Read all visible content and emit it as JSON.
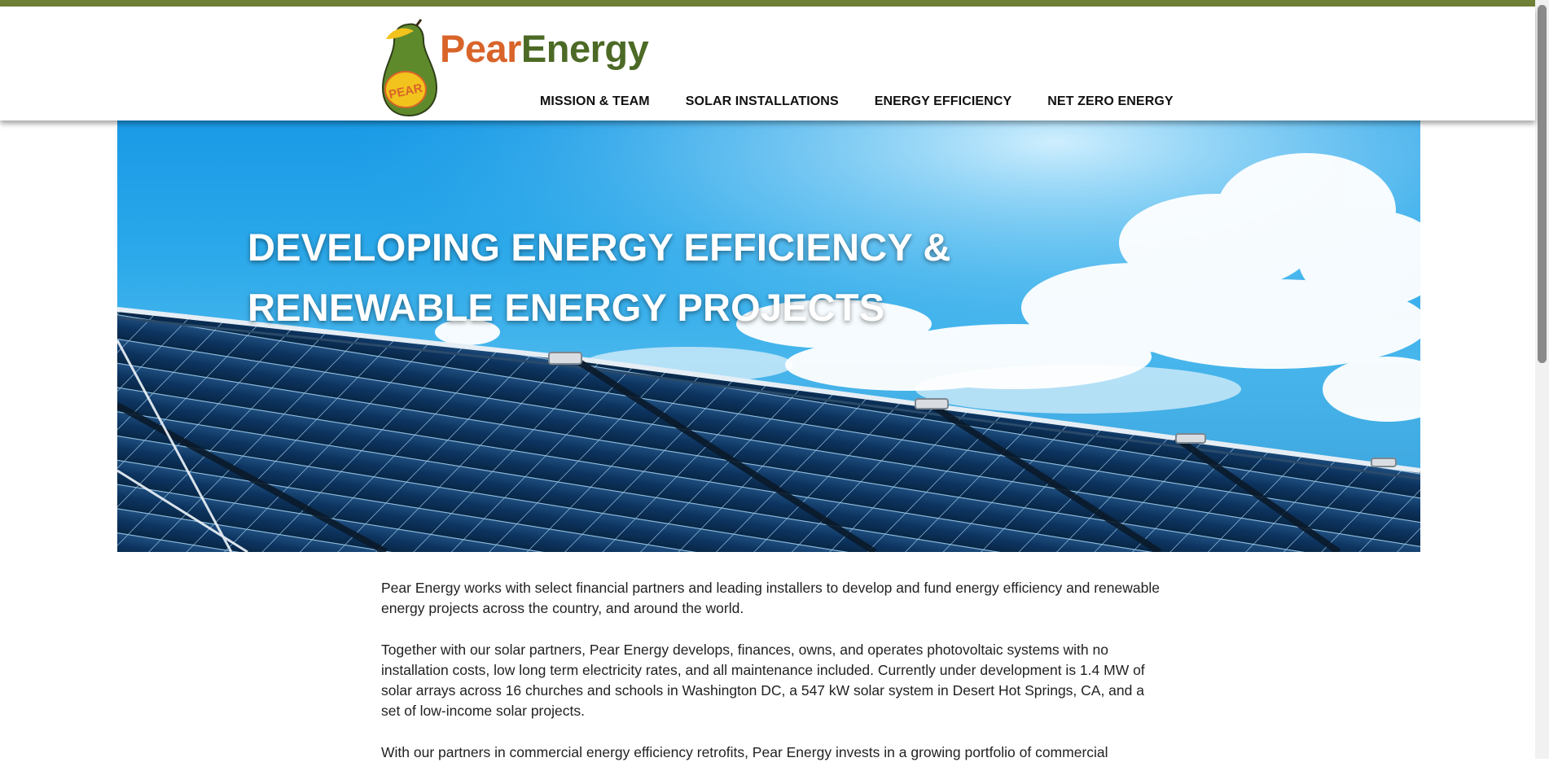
{
  "brand": {
    "name_part1": "Pear",
    "name_part2": "Energy",
    "badge": "PEAR",
    "colors": {
      "green": "#6e7f36",
      "dark_green": "#4c6a25",
      "orange": "#d9642a",
      "yellow": "#f2c31c"
    }
  },
  "nav": {
    "items": [
      {
        "label": "MISSION & TEAM"
      },
      {
        "label": "SOLAR INSTALLATIONS"
      },
      {
        "label": "ENERGY EFFICIENCY"
      },
      {
        "label": "NET ZERO ENERGY"
      }
    ]
  },
  "hero": {
    "title_line1": "DEVELOPING ENERGY EFFICIENCY &",
    "title_line2": "RENEWABLE ENERGY PROJECTS",
    "image": "solar-panels-under-blue-sky"
  },
  "content": {
    "paragraphs": [
      "Pear Energy works with select financial partners and leading installers to develop and fund energy efficiency and renewable energy projects across the country, and around the world.",
      "Together with our solar partners, Pear Energy develops, finances, owns, and operates photovoltaic systems with no installation costs, low long term electricity rates, and all maintenance included. Currently under development is 1.4 MW of solar arrays across 16 churches and schools in Washington DC, a 547 kW solar system in Desert Hot Springs, CA, and a set of low-income solar projects.",
      "With our partners in commercial energy efficiency retrofits, Pear Energy invests in a growing portfolio of commercial"
    ]
  }
}
